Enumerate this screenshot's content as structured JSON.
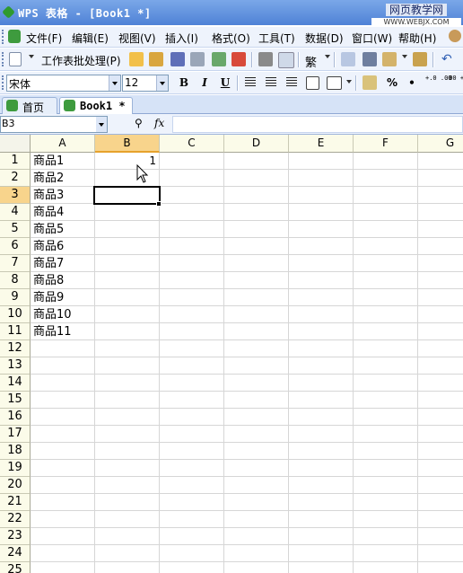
{
  "window": {
    "title": "WPS 表格 - [Book1 *]",
    "watermark_main": "网页教学网",
    "watermark_sub": "WWW.WEBJX.COM"
  },
  "menu": [
    "文件(F)",
    "编辑(E)",
    "视图(V)",
    "插入(I)",
    "格式(O)",
    "工具(T)",
    "数据(D)",
    "窗口(W)",
    "帮助(H)"
  ],
  "toolbar": {
    "batch_label": "工作表批处理(P)",
    "traditional_label": "繁"
  },
  "format": {
    "font_name": "宋体",
    "font_size": "12",
    "bold": "B",
    "italic": "I",
    "underline": "U",
    "percent": "%",
    "inc_decimal": "+.0 .00",
    "dec_decimal": ".00 +.0"
  },
  "tabs": [
    {
      "label": "首页",
      "active": false
    },
    {
      "label": "Book1 *",
      "active": true
    }
  ],
  "formula_bar": {
    "name_box": "B3",
    "fx": "fx",
    "formula": ""
  },
  "sheet": {
    "columns": [
      "A",
      "B",
      "C",
      "D",
      "E",
      "F",
      "G"
    ],
    "selected_column": "B",
    "rows": [
      "1",
      "2",
      "3",
      "4",
      "5",
      "6",
      "7",
      "8",
      "9",
      "10",
      "11",
      "12",
      "13",
      "14",
      "15",
      "16",
      "17",
      "18",
      "19",
      "20",
      "21",
      "22",
      "23",
      "24",
      "25"
    ],
    "selected_row": "3",
    "column_a": [
      "商品1",
      "商品2",
      "商品3",
      "商品4",
      "商品5",
      "商品6",
      "商品7",
      "商品8",
      "商品9",
      "商品10",
      "商品11"
    ],
    "b1_value": "1"
  },
  "colors": {
    "titlebar": "#4f82d6",
    "header_selected": "#f8d48c",
    "header_bg": "#fbfbe9"
  }
}
